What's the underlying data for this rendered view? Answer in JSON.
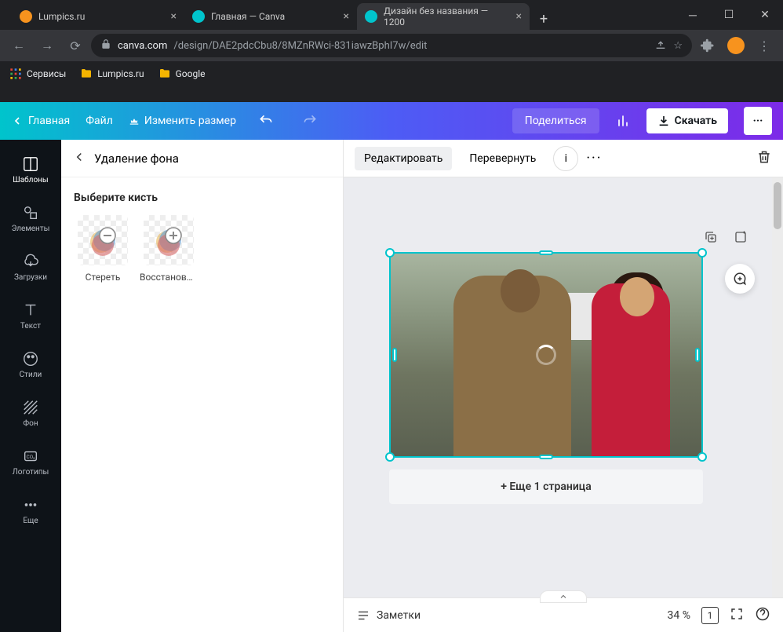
{
  "browser": {
    "tabs": [
      {
        "title": "Lumpics.ru",
        "active": false,
        "icon_color": "#f7931e"
      },
      {
        "title": "Главная — Canva",
        "active": false,
        "icon_color": "#00c4cc"
      },
      {
        "title": "Дизайн без названия — 1200",
        "active": true,
        "icon_color": "#00c4cc"
      }
    ],
    "url_prefix": "canva.com",
    "url_path": "/design/DAE2pdcCbu8/8MZnRWci-831iawzBphI7w/edit",
    "bookmarks": [
      {
        "label": "Сервисы",
        "type": "apps"
      },
      {
        "label": "Lumpics.ru",
        "type": "folder"
      },
      {
        "label": "Google",
        "type": "folder"
      }
    ]
  },
  "header": {
    "home": "Главная",
    "file": "Файл",
    "resize": "Изменить размер",
    "share": "Поделиться",
    "download": "Скачать"
  },
  "siderail": [
    {
      "id": "templates",
      "label": "Шаблоны",
      "active": true
    },
    {
      "id": "elements",
      "label": "Элементы"
    },
    {
      "id": "uploads",
      "label": "Загрузки"
    },
    {
      "id": "text",
      "label": "Текст"
    },
    {
      "id": "styles",
      "label": "Стили"
    },
    {
      "id": "background",
      "label": "Фон"
    },
    {
      "id": "logos",
      "label": "Логотипы"
    },
    {
      "id": "more",
      "label": "Еще"
    }
  ],
  "panel": {
    "title": "Удаление фона",
    "subtitle": "Выберите кисть",
    "brushes": [
      {
        "label": "Стереть",
        "op": "minus"
      },
      {
        "label": "Восстанови...",
        "op": "plus"
      }
    ]
  },
  "canvas_toolbar": {
    "edit": "Редактировать",
    "flip": "Перевернуть"
  },
  "canvas": {
    "add_page": "+ Еще 1 страница"
  },
  "footer": {
    "notes": "Заметки",
    "zoom": "34 %",
    "page": "1"
  }
}
